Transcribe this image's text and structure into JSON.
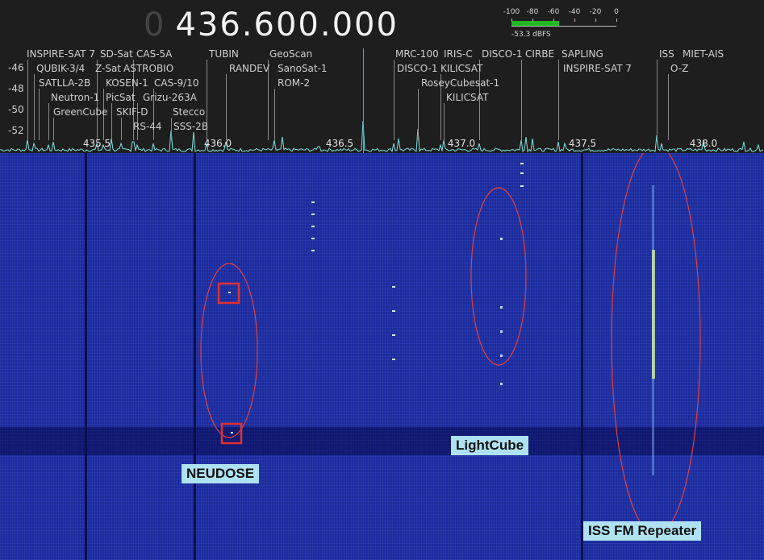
{
  "frequency": {
    "dim_digit": "0",
    "value": "436.600.000"
  },
  "level_meter": {
    "scale": [
      "-100",
      "-80",
      "-60",
      "-40",
      "-20",
      "0"
    ],
    "readout": "-53.3 dBFS",
    "level_fraction": 0.45,
    "fill_color": "#21b821"
  },
  "db_axis": [
    "-46",
    "-48",
    "-50",
    "-52"
  ],
  "freq_axis": [
    "435.5",
    "436.0",
    "436.5",
    "437.0",
    "437.5",
    "438.0"
  ],
  "satellites": [
    "INSPIRE-SAT 7",
    "SD-Sat",
    "CAS-5A",
    "QUBIK-3/4",
    "Z-Sat",
    "ASTROBIO",
    "SATLLA-2B",
    "KOSEN-1",
    "CAS-9/10",
    "Neutron-1",
    "PicSat",
    "Grizu-263A",
    "GreenCube",
    "SKIF-D",
    "Stecco",
    "RS-44",
    "SSS-2B",
    "TUBIN",
    "RANDEV",
    "GeoScan",
    "SanoSat-1",
    "ROM-2",
    "MRC-100",
    "IRIS-C",
    "DISCO-1",
    "CIRBE",
    "SAPLING",
    "DISCO-1",
    "KILICSAT",
    "RoseyCubesat-1",
    "KILICSAT",
    "INSPIRE-SAT 7",
    "ISS",
    "MIET-AIS",
    "O-Z"
  ],
  "annotations": {
    "neudose": "NEUDOSE",
    "lightcube": "LightCube",
    "iss_repeater": "ISS FM Repeater"
  },
  "colors": {
    "waterfall_bg": "#1c2c9c",
    "annotation_ellipse": "#e04040",
    "annotation_box": "#e03030",
    "callout_bg": "#aee2f2",
    "spectrum_trace": "#7fe0e0",
    "center_marker": "#e07060"
  }
}
